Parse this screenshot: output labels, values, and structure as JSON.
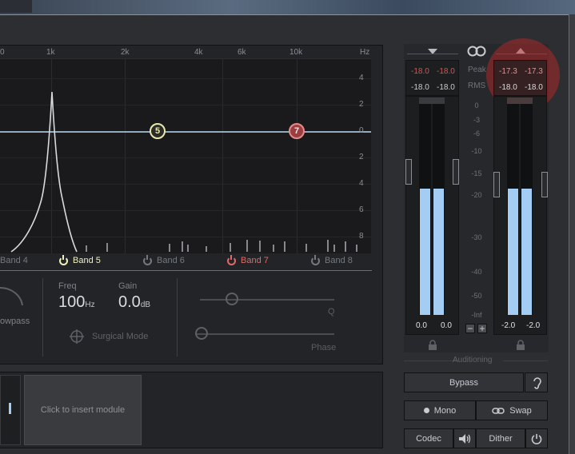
{
  "freq_labels": [
    "0",
    "1k",
    "2k",
    "4k",
    "6k",
    "10k",
    "Hz"
  ],
  "db_labels": [
    "4",
    "2",
    "0",
    "2",
    "4",
    "6",
    "8"
  ],
  "bands": [
    {
      "label": "Band 4"
    },
    {
      "label": "Band 5"
    },
    {
      "label": "Band 6"
    },
    {
      "label": "Band 7"
    },
    {
      "label": "Band 8"
    }
  ],
  "nodes": [
    {
      "label": "5"
    },
    {
      "label": "7"
    }
  ],
  "controls": {
    "filter_type": "owpass",
    "freq_label": "Freq",
    "freq_value": "100",
    "freq_unit": "Hz",
    "gain_label": "Gain",
    "gain_value": "0.0",
    "gain_unit": "dB",
    "surgical_mode": "Surgical Mode",
    "q_label": "Q",
    "phase_label": "Phase"
  },
  "insert": {
    "label": "Click to insert module"
  },
  "meters": {
    "left_peak": [
      "-18.0",
      "-18.0"
    ],
    "left_rms": [
      "-18.0",
      "-18.0"
    ],
    "right_peak": [
      "-17.3",
      "-17.3"
    ],
    "right_rms": [
      "-18.0",
      "-18.0"
    ],
    "peak_label": "Peak",
    "rms_label": "RMS",
    "scale": [
      "0",
      "-3",
      "-6",
      "-10",
      "-15",
      "-20",
      "-30",
      "-40",
      "-50",
      "-Inf"
    ],
    "left_bottom": [
      "0.0",
      "0.0"
    ],
    "right_bottom": [
      "-2.0",
      "-2.0"
    ],
    "left_level": 0.58,
    "right_level": 0.58
  },
  "buttons": {
    "auditioning": "Auditioning",
    "bypass": "Bypass",
    "mono": "Mono",
    "swap": "Swap",
    "codec": "Codec",
    "dither": "Dither"
  },
  "colors": {
    "accent_blue": "#a3cdf2",
    "band5": "#e8e8b0",
    "band7": "#e06a6a",
    "peak_red": "#c85a5a"
  }
}
